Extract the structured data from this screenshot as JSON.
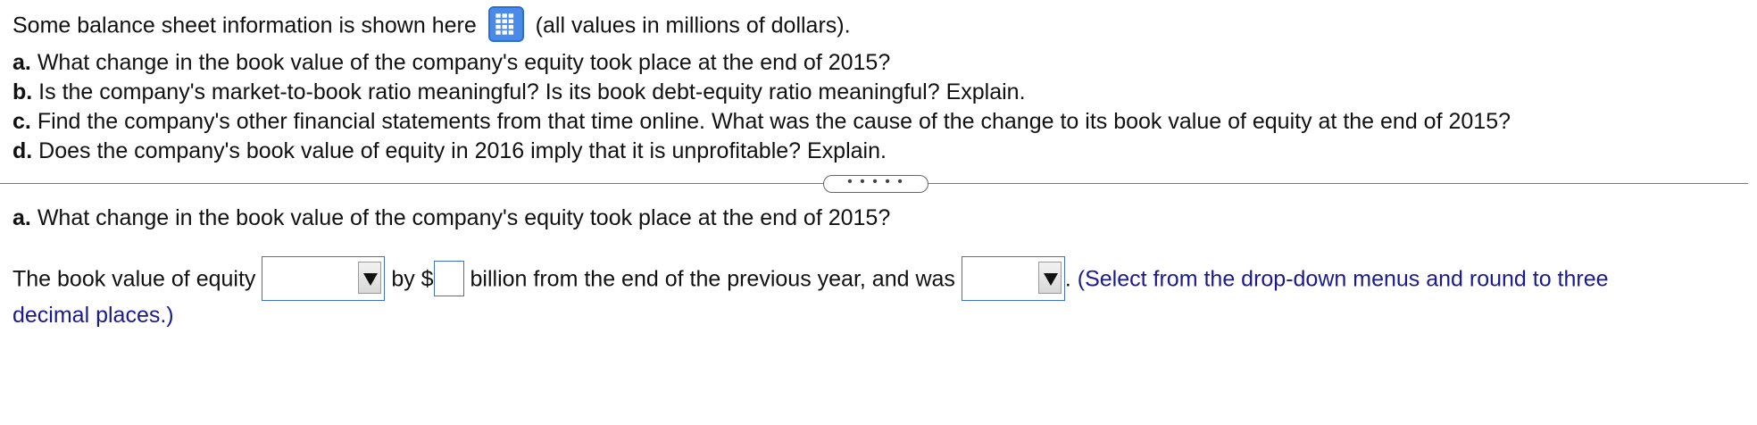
{
  "intro": {
    "before_icon": "Some balance sheet information is shown here",
    "icon": "table-grid-icon",
    "after_icon": "(all values in millions of dollars)."
  },
  "questions": [
    {
      "label": "a.",
      "text": "What change in the book value of the company's equity took place at the end of 2015?"
    },
    {
      "label": "b.",
      "text": "Is the company's market-to-book ratio meaningful? Is its book debt-equity ratio meaningful? Explain."
    },
    {
      "label": "c.",
      "text": "Find the company's other financial statements from that time online. What was the cause of the change to its book value of equity at the end of 2015?"
    },
    {
      "label": "d.",
      "text": "Does the company's book value of equity in 2016 imply that it is unprofitable? Explain."
    }
  ],
  "expander": {
    "label": "• • • • •"
  },
  "part_a": {
    "label": "a.",
    "text": "What change in the book value of the company's equity took place at the end of 2015?"
  },
  "answer": {
    "prefix": "The book value of equity",
    "select1_value": "",
    "by_text": "by $",
    "amount_value": "",
    "middle_text": "billion from the end of the previous year, and was",
    "select2_value": "",
    "period": ".",
    "hint_line1": "(Select from the drop-down menus and round to three",
    "hint_line2": "decimal places.)"
  },
  "colors": {
    "accent": "#3f6fd0",
    "hint_text": "#1a1a8c",
    "icon_fill": "#4b8ae6"
  }
}
